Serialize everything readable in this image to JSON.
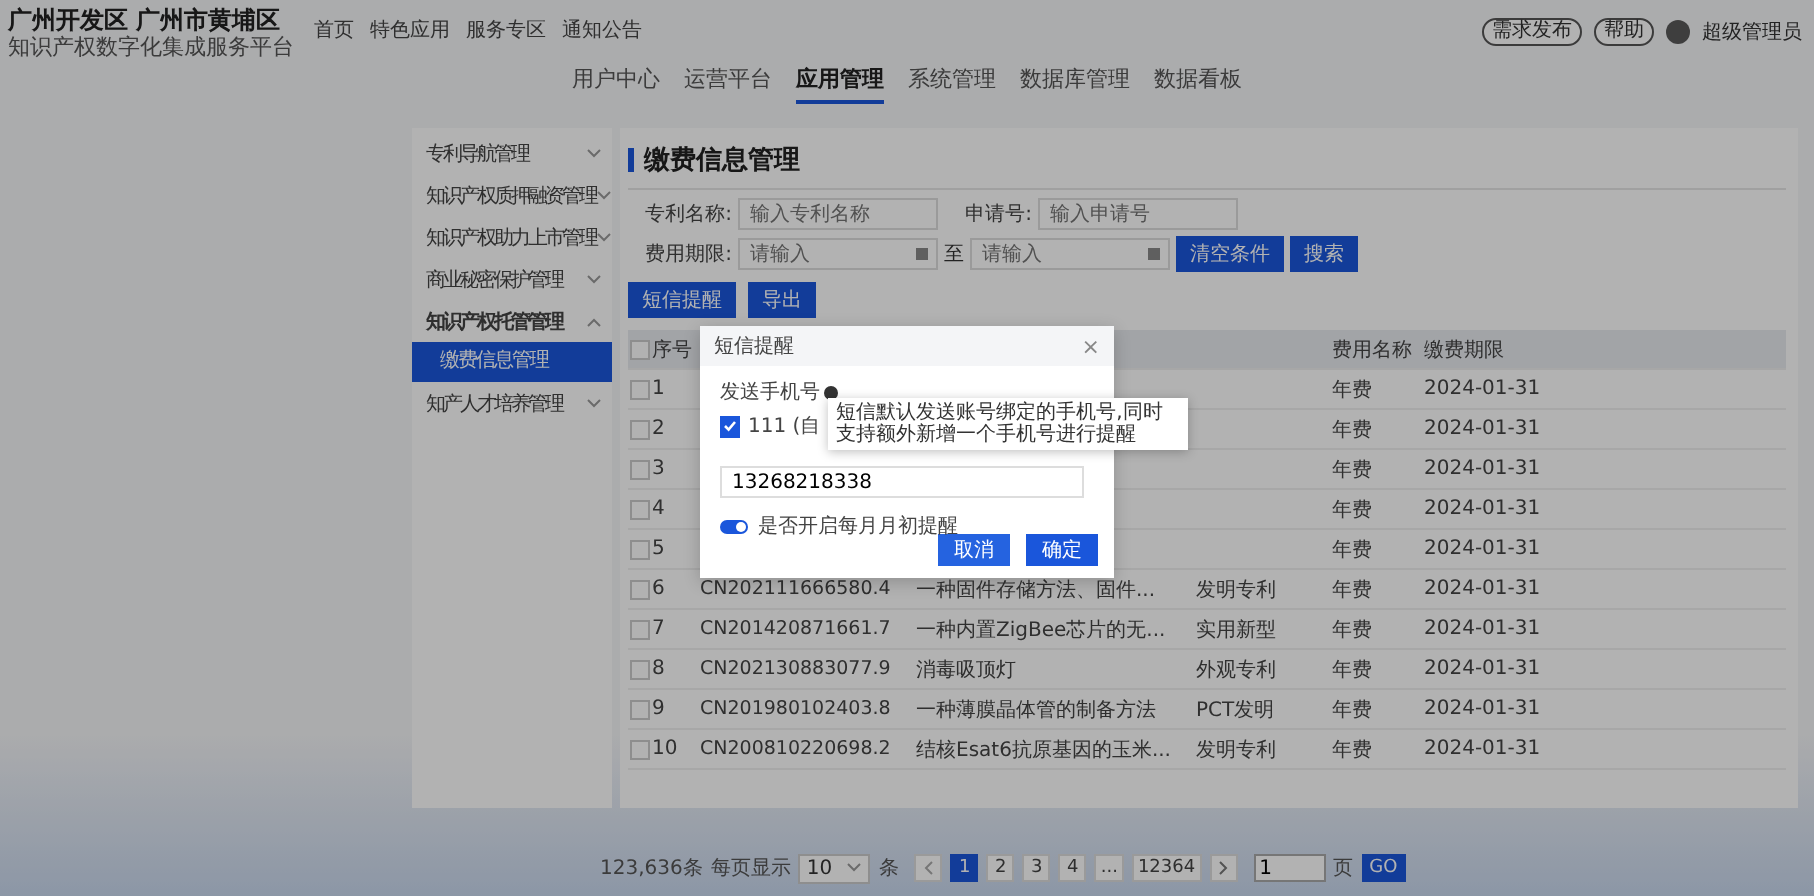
{
  "header": {
    "title": "广州开发区 广州市黄埔区",
    "subtitle": "知识产权数字化集成服务平台",
    "links": [
      "首页",
      "特色应用",
      "服务专区",
      "通知公告"
    ],
    "actions": [
      "需求发布",
      "帮助"
    ],
    "user": "超级管理员"
  },
  "tabs": [
    {
      "label": "用户中心",
      "selected": false
    },
    {
      "label": "运营平台",
      "selected": false
    },
    {
      "label": "应用管理",
      "selected": true
    },
    {
      "label": "系统管理",
      "selected": false
    },
    {
      "label": "数据库管理",
      "selected": false
    },
    {
      "label": "数据看板",
      "selected": false
    }
  ],
  "sidebar": {
    "items": [
      {
        "label": "专利导航管理",
        "expanded": false
      },
      {
        "label": "知识产权质押融资管理",
        "expanded": false
      },
      {
        "label": "知识产权助力上市管理",
        "expanded": false
      },
      {
        "label": "商业秘密保护管理",
        "expanded": false
      },
      {
        "label": "知识产权托管管理",
        "expanded": true,
        "children": [
          {
            "label": "缴费信息管理",
            "selected": true
          }
        ]
      },
      {
        "label": "知产人才培养管理",
        "expanded": false
      }
    ]
  },
  "page_title": "缴费信息管理",
  "filters": {
    "patent_name": {
      "label": "专利名称:",
      "placeholder": "输入专利名称"
    },
    "app_no": {
      "label": "申请号:",
      "placeholder": "输入申请号"
    },
    "deadline": {
      "label": "费用期限:",
      "from_placeholder": "请输入",
      "separator": "至",
      "to_placeholder": "请输入"
    },
    "buttons": [
      "清空条件",
      "搜索"
    ]
  },
  "toolbar": [
    "短信提醒",
    "导出"
  ],
  "table": {
    "header_checked": false,
    "columns": {
      "seq": "序号",
      "fee": "费用名称",
      "deadline": "缴费期限"
    },
    "rows": [
      {
        "checked": false,
        "seq": "1",
        "fee": "年费",
        "deadline": "2024-01-31"
      },
      {
        "checked": false,
        "seq": "2",
        "fee": "年费",
        "deadline": "2024-01-31"
      },
      {
        "checked": false,
        "seq": "3",
        "fee": "年费",
        "deadline": "2024-01-31"
      },
      {
        "checked": false,
        "seq": "4",
        "fee": "年费",
        "deadline": "2024-01-31"
      },
      {
        "checked": false,
        "seq": "5",
        "fee": "年费",
        "deadline": "2024-01-31"
      },
      {
        "checked": false,
        "seq": "6",
        "app_no": "CN202111666580.4",
        "name": "一种固件存储方法、固件...",
        "type": "发明专利",
        "fee": "年费",
        "deadline": "2024-01-31"
      },
      {
        "checked": false,
        "seq": "7",
        "app_no": "CN201420871661.7",
        "name": "一种内置ZigBee芯片的无...",
        "type": "实用新型",
        "fee": "年费",
        "deadline": "2024-01-31"
      },
      {
        "checked": false,
        "seq": "8",
        "app_no": "CN202130883077.9",
        "name": "消毒吸顶灯",
        "type": "外观专利",
        "fee": "年费",
        "deadline": "2024-01-31"
      },
      {
        "checked": false,
        "seq": "9",
        "app_no": "CN201980102403.8",
        "name": "一种薄膜晶体管的制备方法",
        "type": "PCT发明",
        "fee": "年费",
        "deadline": "2024-01-31"
      },
      {
        "checked": false,
        "seq": "10",
        "app_no": "CN200810220698.2",
        "name": "结核Esat6抗原基因的玉米...",
        "type": "发明专利",
        "fee": "年费",
        "deadline": "2024-01-31"
      }
    ]
  },
  "pagination": {
    "total": "123,636条",
    "per_page_label": "每页显示",
    "per_page": "10",
    "unit": "条",
    "pages": [
      {
        "label": "1",
        "selected": true
      },
      {
        "label": "2",
        "selected": false
      },
      {
        "label": "3",
        "selected": false
      },
      {
        "label": "4",
        "selected": false
      },
      {
        "label": "...",
        "selected": false
      },
      {
        "label": "12364",
        "selected": false
      }
    ],
    "jump_value": "1",
    "jump_unit": "页",
    "go": "GO"
  },
  "modal": {
    "title": "短信提醒",
    "close": "×",
    "phone_label": "发送手机号",
    "own_phone": {
      "label": "111 (自",
      "checked": true
    },
    "tooltip": "短信默认发送账号绑定的手机号,同时支持额外新增一个手机号进行提醒",
    "extra_phone": "13268218338",
    "monthly_reminder": {
      "label": "是否开启每月月初提醒",
      "on": true
    },
    "buttons": [
      {
        "label": "取消",
        "kind": "cancel"
      },
      {
        "label": "确定",
        "kind": "confirm"
      }
    ]
  }
}
